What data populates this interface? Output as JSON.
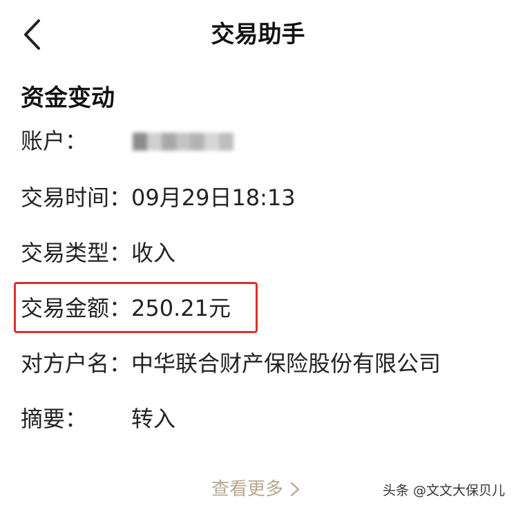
{
  "header": {
    "title": "交易助手"
  },
  "section": {
    "title": "资金变动"
  },
  "fields": {
    "account": {
      "label": "账户："
    },
    "time": {
      "label": "交易时间：",
      "value": "09月29日18:13"
    },
    "type": {
      "label": "交易类型：",
      "value": "收入"
    },
    "amount": {
      "label": "交易金额：",
      "value": "250.21元"
    },
    "counterparty": {
      "label": "对方户名：",
      "value": "中华联合财产保险股份有限公司"
    },
    "summary": {
      "label": "摘要：",
      "value": "转入"
    }
  },
  "footer": {
    "view_more": "查看更多"
  },
  "watermark": "头条 @文文大保贝儿",
  "colors": {
    "highlight": "#d9312b",
    "view_more": "#b8a890"
  }
}
